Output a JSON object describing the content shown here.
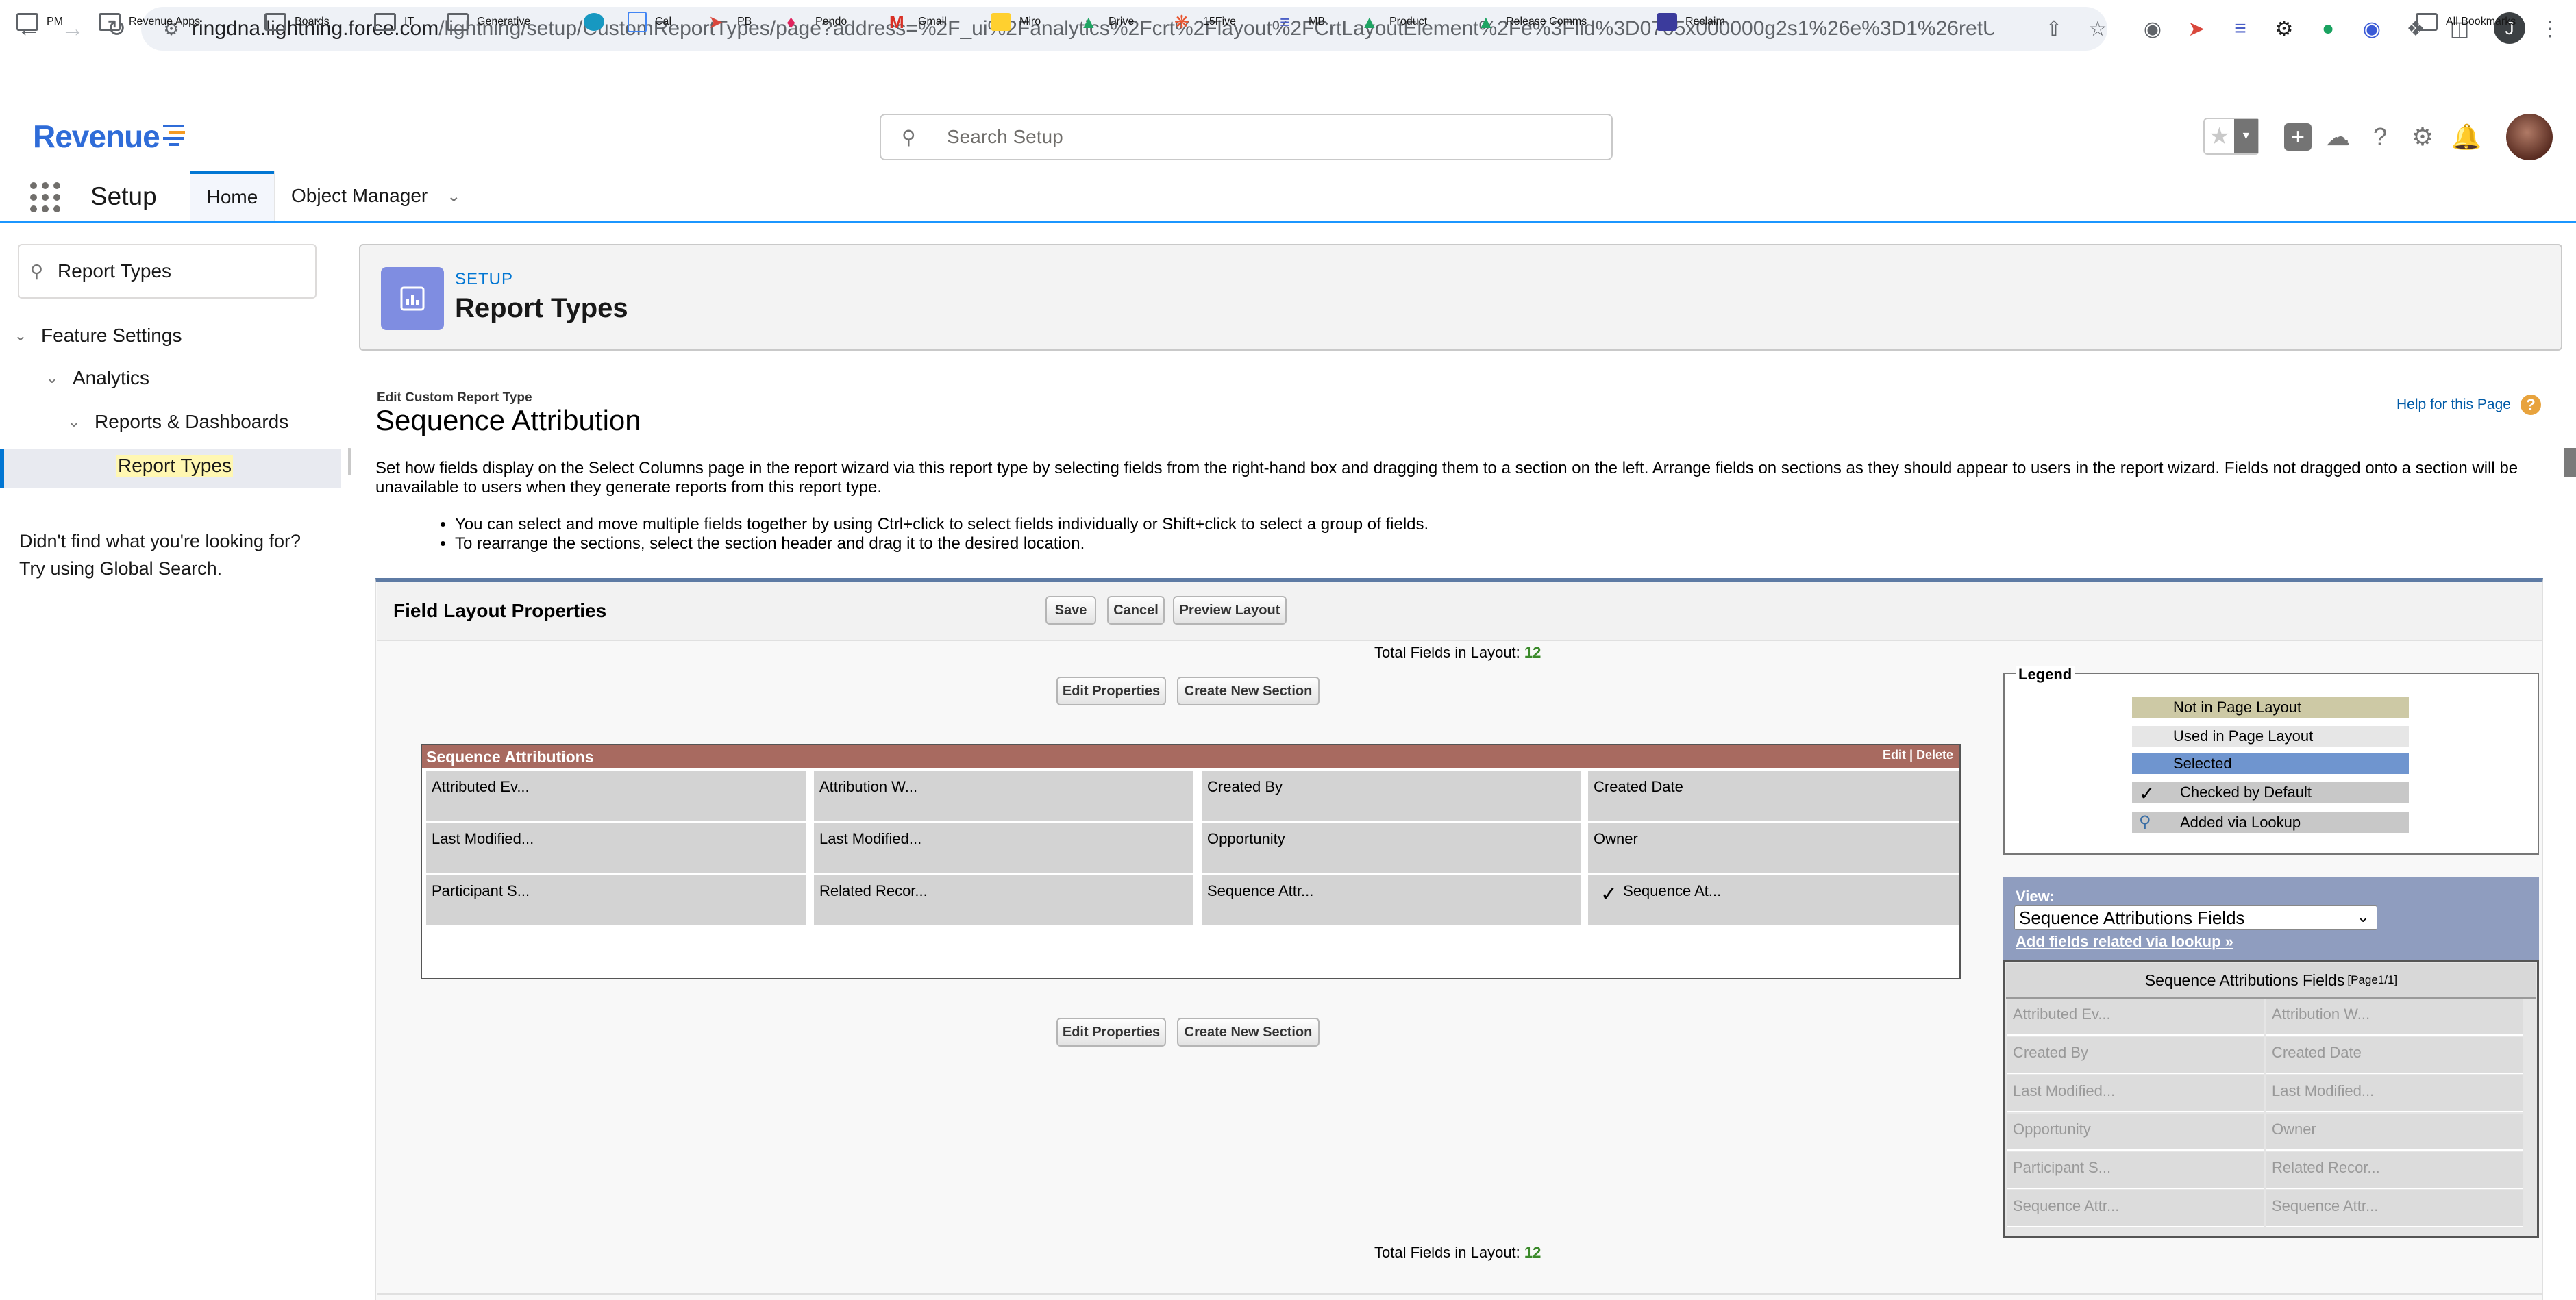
{
  "browser": {
    "url_host": "ringdna.lightning.force.com",
    "url_path": "/lightning/setup/CustomReportTypes/page?address=%2F_ui%2Fanalytics%2Fcrt%2Flayout%2FCrtLayoutElement%2Fe%3Flid%3D0705x000000g2s1%26e%3D1%26retURL...",
    "profile_initial": "J",
    "bookmarks": [
      "PM",
      "Revenue Apps",
      "Boards",
      "IT",
      "Generative",
      "Cal",
      "PB",
      "Pendo",
      "Gmail",
      "Miro",
      "Drive",
      "15Five",
      "MB",
      "Product",
      "Release Comms",
      "Reclaim"
    ],
    "all_bookmarks": "All Bookmarks"
  },
  "header": {
    "logo": "Revenue",
    "search_placeholder": "Search Setup"
  },
  "setup_nav": {
    "title": "Setup",
    "tabs": [
      "Home",
      "Object Manager"
    ]
  },
  "sidebar": {
    "quick_find_value": "Report Types",
    "tree": [
      "Feature Settings",
      "Analytics",
      "Reports & Dashboards",
      "Report Types"
    ],
    "help_text_1": "Didn't find what you're looking for?",
    "help_text_2": "Try using Global Search."
  },
  "page_header": {
    "eyebrow": "SETUP",
    "title": "Report Types"
  },
  "content": {
    "edit_label": "Edit Custom Report Type",
    "title": "Sequence Attribution",
    "help_link": "Help for this Page",
    "description": "Set how fields display on the Select Columns page in the report wizard via this report type by selecting fields from the right-hand box and dragging them to a section on the left. Arrange fields on sections as they should appear to users in the report wizard. Fields not dragged onto a section will be unavailable to users when they generate reports from this report type.",
    "tips": [
      "You can select and move multiple fields together by using Ctrl+click to select fields individually or Shift+click to select a group of fields.",
      "To rearrange the sections, select the section header and drag it to the desired location."
    ]
  },
  "layout_panel": {
    "title": "Field Layout Properties",
    "buttons": {
      "save": "Save",
      "cancel": "Cancel",
      "preview": "Preview Layout"
    },
    "total_label": "Total Fields in Layout:",
    "total_value": "12",
    "edit_properties": "Edit Properties",
    "create_section": "Create New Section",
    "section": {
      "name": "Sequence Attributions",
      "actions": "Edit | Delete",
      "fields": [
        "Attributed Ev...",
        "Attribution W...",
        "Created By",
        "Created Date",
        "Last Modified...",
        "Last Modified...",
        "Opportunity",
        "Owner",
        "Participant S...",
        "Related Recor...",
        "Sequence Attr...",
        "Sequence At..."
      ]
    }
  },
  "legend": {
    "title": "Legend",
    "items": [
      "Not in Page Layout",
      "Used in Page Layout",
      "Selected",
      "Checked by Default",
      "Added via Lookup"
    ]
  },
  "view": {
    "label": "View:",
    "selected": "Sequence Attributions Fields",
    "add_lookup": "Add fields related via lookup »",
    "box_title": "Sequence Attributions Fields",
    "box_page": "[Page1/1]",
    "fields": [
      "Attributed Ev...",
      "Attribution W...",
      "Created By",
      "Created Date",
      "Last Modified...",
      "Last Modified...",
      "Opportunity",
      "Owner",
      "Participant S...",
      "Related Recor...",
      "Sequence Attr...",
      "Sequence Attr..."
    ]
  },
  "colors": {
    "section_header": "#a86a60",
    "not_in_layout": "#cdc9a5",
    "selected": "#6f95cf",
    "brand_blue": "#0176d3"
  }
}
